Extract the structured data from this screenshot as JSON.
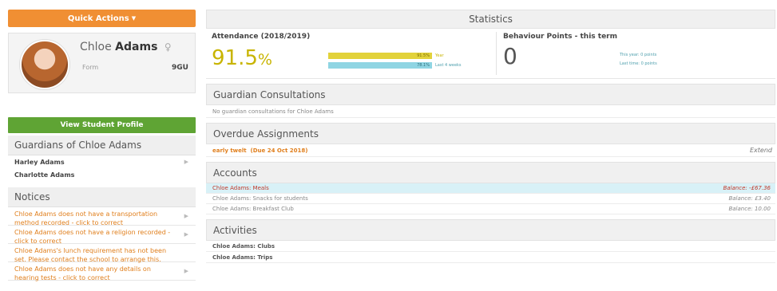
{
  "quick_actions": {
    "label": "Quick Actions",
    "icon": "caret-down-icon"
  },
  "student": {
    "first_name": "Chloe",
    "last_name": "Adams",
    "form_label": "Form",
    "form_value": "9GU"
  },
  "view_profile_label": "View Student Profile",
  "guardians": {
    "title": "Guardians of Chloe Adams",
    "items": [
      "Harley Adams",
      "Charlotte Adams"
    ]
  },
  "notices": {
    "title": "Notices",
    "items": [
      "Chloe Adams does not have a transportation method recorded - click to correct",
      "Chloe Adams does not have a religion recorded - click to correct",
      "Chloe Adams's lunch requirement has not been set. Please contact the school to arrange this.",
      "Chloe Adams does not have any details on hearing tests - click to correct"
    ]
  },
  "statistics": {
    "title": "Statistics",
    "attendance": {
      "title": "Attendance (2018/2019)",
      "value": "91.5",
      "unit": "%",
      "bar1_label": "91.5%",
      "bar1_caption": "Year",
      "bar2_label": "78.1%",
      "bar2_caption": "Last 4 weeks"
    },
    "behaviour": {
      "title": "Behaviour Points - this term",
      "value": "0",
      "line1": "This year: 0 points",
      "line2": "Last time: 0 points"
    }
  },
  "consultations": {
    "title": "Guardian Consultations",
    "empty_text": "No guardian consultations for Chloe Adams"
  },
  "overdue": {
    "title": "Overdue Assignments",
    "item_title": "early twelt",
    "item_due": "(Due 24 Oct 2018)",
    "extend_label": "Extend"
  },
  "accounts": {
    "title": "Accounts",
    "rows": [
      {
        "name": "Chloe Adams: Meals",
        "balance": "Balance: -£67.36"
      },
      {
        "name": "Chloe Adams: Snacks for students",
        "balance": "Balance: £3.40"
      },
      {
        "name": "Chloe Adams: Breakfast Club",
        "balance": "Balance: 10.00"
      }
    ]
  },
  "activities": {
    "title": "Activities",
    "rows": [
      "Chloe Adams: Clubs",
      "Chloe Adams: Trips"
    ]
  }
}
